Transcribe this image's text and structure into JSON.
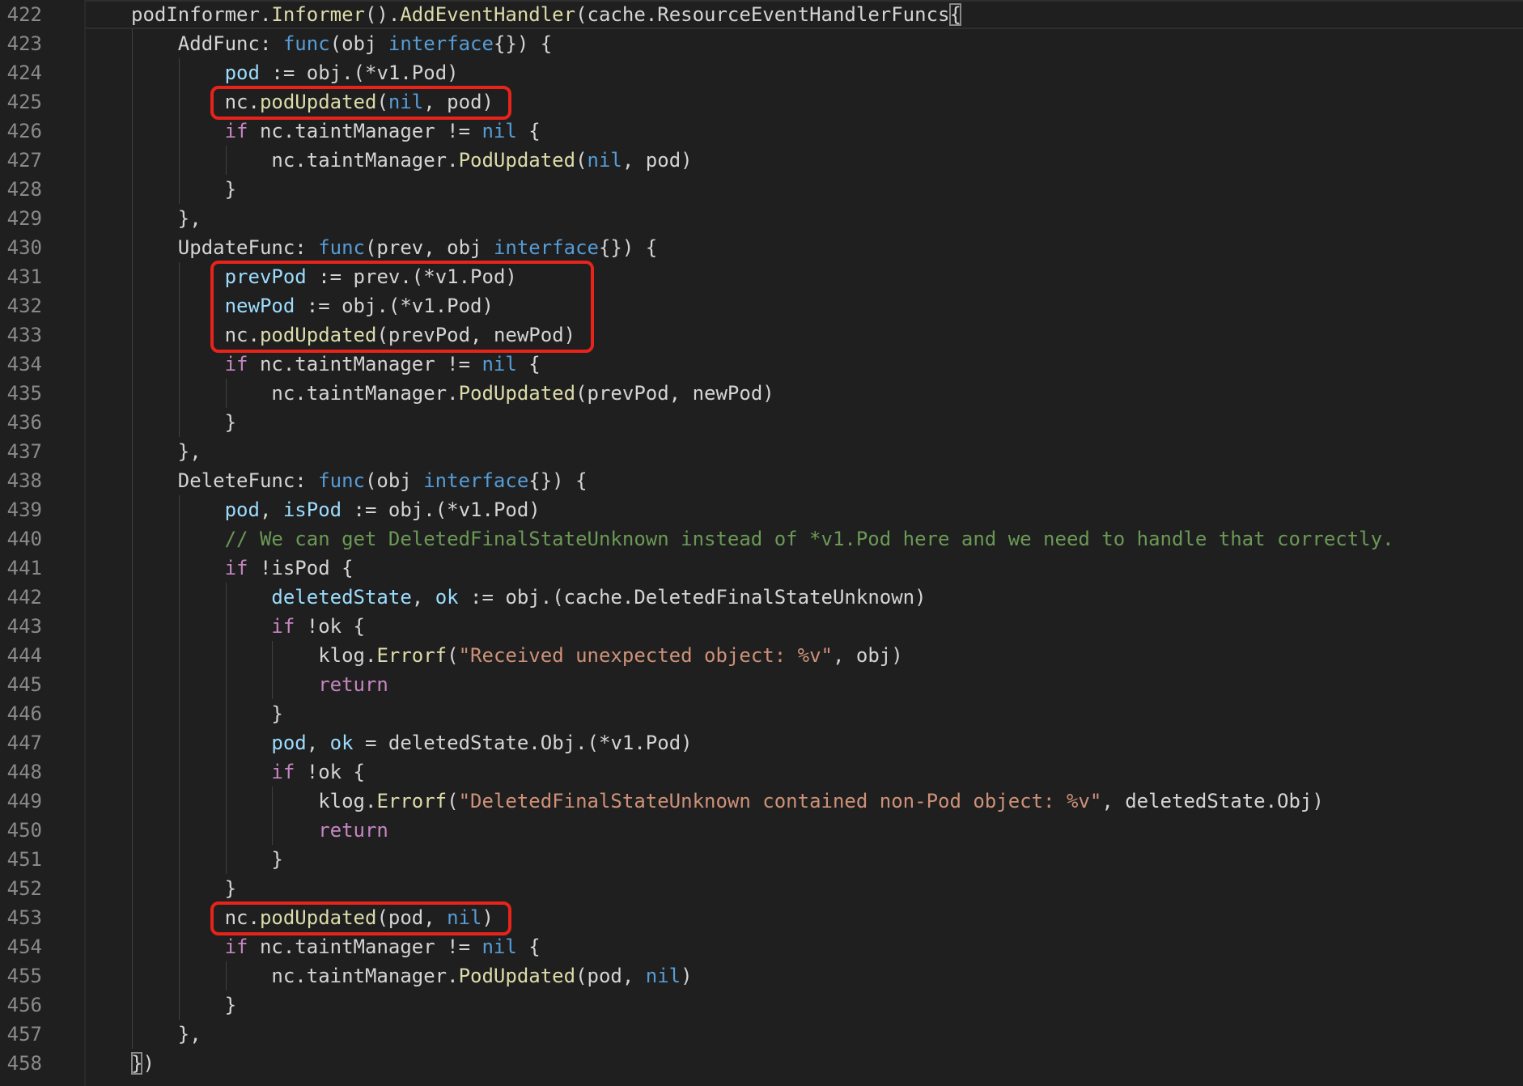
{
  "editor": {
    "language": "go",
    "first_line": 422,
    "lines": [
      {
        "n": "422",
        "indent": 0,
        "tokens": [
          [
            "txt",
            "podInformer."
          ],
          [
            "fn",
            "Informer"
          ],
          [
            "txt",
            "()."
          ],
          [
            "fn",
            "AddEventHandler"
          ],
          [
            "txt",
            "(cache.ResourceEventHandlerFuncs"
          ],
          [
            "brk",
            "{"
          ]
        ]
      },
      {
        "n": "423",
        "indent": 1,
        "tokens": [
          [
            "txt",
            "AddFunc: "
          ],
          [
            "kw",
            "func"
          ],
          [
            "txt",
            "(obj "
          ],
          [
            "kw",
            "interface"
          ],
          [
            "txt",
            "{}) {"
          ]
        ]
      },
      {
        "n": "424",
        "indent": 2,
        "tokens": [
          [
            "var",
            "pod"
          ],
          [
            "txt",
            " := obj.(*v1.Pod)"
          ]
        ]
      },
      {
        "n": "425",
        "indent": 2,
        "tokens": [
          [
            "txt",
            "nc."
          ],
          [
            "fn",
            "podUpdated"
          ],
          [
            "txt",
            "("
          ],
          [
            "kw",
            "nil"
          ],
          [
            "txt",
            ", pod)"
          ]
        ]
      },
      {
        "n": "426",
        "indent": 2,
        "tokens": [
          [
            "ctl",
            "if"
          ],
          [
            "txt",
            " nc.taintManager != "
          ],
          [
            "kw",
            "nil"
          ],
          [
            "txt",
            " {"
          ]
        ]
      },
      {
        "n": "427",
        "indent": 3,
        "tokens": [
          [
            "txt",
            "nc.taintManager."
          ],
          [
            "fn",
            "PodUpdated"
          ],
          [
            "txt",
            "("
          ],
          [
            "kw",
            "nil"
          ],
          [
            "txt",
            ", pod)"
          ]
        ]
      },
      {
        "n": "428",
        "indent": 2,
        "tokens": [
          [
            "txt",
            "}"
          ]
        ]
      },
      {
        "n": "429",
        "indent": 1,
        "tokens": [
          [
            "txt",
            "},"
          ]
        ]
      },
      {
        "n": "430",
        "indent": 1,
        "tokens": [
          [
            "txt",
            "UpdateFunc: "
          ],
          [
            "kw",
            "func"
          ],
          [
            "txt",
            "(prev, obj "
          ],
          [
            "kw",
            "interface"
          ],
          [
            "txt",
            "{}) {"
          ]
        ]
      },
      {
        "n": "431",
        "indent": 2,
        "tokens": [
          [
            "var",
            "prevPod"
          ],
          [
            "txt",
            " := prev.(*v1.Pod)"
          ]
        ]
      },
      {
        "n": "432",
        "indent": 2,
        "tokens": [
          [
            "var",
            "newPod"
          ],
          [
            "txt",
            " := obj.(*v1.Pod)"
          ]
        ]
      },
      {
        "n": "433",
        "indent": 2,
        "tokens": [
          [
            "txt",
            "nc."
          ],
          [
            "fn",
            "podUpdated"
          ],
          [
            "txt",
            "(prevPod, newPod)"
          ]
        ]
      },
      {
        "n": "434",
        "indent": 2,
        "tokens": [
          [
            "ctl",
            "if"
          ],
          [
            "txt",
            " nc.taintManager != "
          ],
          [
            "kw",
            "nil"
          ],
          [
            "txt",
            " {"
          ]
        ]
      },
      {
        "n": "435",
        "indent": 3,
        "tokens": [
          [
            "txt",
            "nc.taintManager."
          ],
          [
            "fn",
            "PodUpdated"
          ],
          [
            "txt",
            "(prevPod, newPod)"
          ]
        ]
      },
      {
        "n": "436",
        "indent": 2,
        "tokens": [
          [
            "txt",
            "}"
          ]
        ]
      },
      {
        "n": "437",
        "indent": 1,
        "tokens": [
          [
            "txt",
            "},"
          ]
        ]
      },
      {
        "n": "438",
        "indent": 1,
        "tokens": [
          [
            "txt",
            "DeleteFunc: "
          ],
          [
            "kw",
            "func"
          ],
          [
            "txt",
            "(obj "
          ],
          [
            "kw",
            "interface"
          ],
          [
            "txt",
            "{}) {"
          ]
        ]
      },
      {
        "n": "439",
        "indent": 2,
        "tokens": [
          [
            "var",
            "pod"
          ],
          [
            "txt",
            ", "
          ],
          [
            "var",
            "isPod"
          ],
          [
            "txt",
            " := obj.(*v1.Pod)"
          ]
        ]
      },
      {
        "n": "440",
        "indent": 2,
        "tokens": [
          [
            "cmt",
            "// We can get DeletedFinalStateUnknown instead of *v1.Pod here and we need to handle that correctly."
          ]
        ]
      },
      {
        "n": "441",
        "indent": 2,
        "tokens": [
          [
            "ctl",
            "if"
          ],
          [
            "txt",
            " !isPod {"
          ]
        ]
      },
      {
        "n": "442",
        "indent": 3,
        "tokens": [
          [
            "var",
            "deletedState"
          ],
          [
            "txt",
            ", "
          ],
          [
            "var",
            "ok"
          ],
          [
            "txt",
            " := obj.(cache.DeletedFinalStateUnknown)"
          ]
        ]
      },
      {
        "n": "443",
        "indent": 3,
        "tokens": [
          [
            "ctl",
            "if"
          ],
          [
            "txt",
            " !ok {"
          ]
        ]
      },
      {
        "n": "444",
        "indent": 4,
        "tokens": [
          [
            "txt",
            "klog."
          ],
          [
            "fn",
            "Errorf"
          ],
          [
            "txt",
            "("
          ],
          [
            "str",
            "\"Received unexpected object: %v\""
          ],
          [
            "txt",
            ", obj)"
          ]
        ]
      },
      {
        "n": "445",
        "indent": 4,
        "tokens": [
          [
            "ctl",
            "return"
          ]
        ]
      },
      {
        "n": "446",
        "indent": 3,
        "tokens": [
          [
            "txt",
            "}"
          ]
        ]
      },
      {
        "n": "447",
        "indent": 3,
        "tokens": [
          [
            "var",
            "pod"
          ],
          [
            "txt",
            ", "
          ],
          [
            "var",
            "ok"
          ],
          [
            "txt",
            " = deletedState.Obj.(*v1.Pod)"
          ]
        ]
      },
      {
        "n": "448",
        "indent": 3,
        "tokens": [
          [
            "ctl",
            "if"
          ],
          [
            "txt",
            " !ok {"
          ]
        ]
      },
      {
        "n": "449",
        "indent": 4,
        "tokens": [
          [
            "txt",
            "klog."
          ],
          [
            "fn",
            "Errorf"
          ],
          [
            "txt",
            "("
          ],
          [
            "str",
            "\"DeletedFinalStateUnknown contained non-Pod object: %v\""
          ],
          [
            "txt",
            ", deletedState.Obj)"
          ]
        ]
      },
      {
        "n": "450",
        "indent": 4,
        "tokens": [
          [
            "ctl",
            "return"
          ]
        ]
      },
      {
        "n": "451",
        "indent": 3,
        "tokens": [
          [
            "txt",
            "}"
          ]
        ]
      },
      {
        "n": "452",
        "indent": 2,
        "tokens": [
          [
            "txt",
            "}"
          ]
        ]
      },
      {
        "n": "453",
        "indent": 2,
        "tokens": [
          [
            "txt",
            "nc."
          ],
          [
            "fn",
            "podUpdated"
          ],
          [
            "txt",
            "(pod, "
          ],
          [
            "kw",
            "nil"
          ],
          [
            "txt",
            ")"
          ]
        ]
      },
      {
        "n": "454",
        "indent": 2,
        "tokens": [
          [
            "ctl",
            "if"
          ],
          [
            "txt",
            " nc.taintManager != "
          ],
          [
            "kw",
            "nil"
          ],
          [
            "txt",
            " {"
          ]
        ]
      },
      {
        "n": "455",
        "indent": 3,
        "tokens": [
          [
            "txt",
            "nc.taintManager."
          ],
          [
            "fn",
            "PodUpdated"
          ],
          [
            "txt",
            "(pod, "
          ],
          [
            "kw",
            "nil"
          ],
          [
            "txt",
            ")"
          ]
        ]
      },
      {
        "n": "456",
        "indent": 2,
        "tokens": [
          [
            "txt",
            "}"
          ]
        ]
      },
      {
        "n": "457",
        "indent": 1,
        "tokens": [
          [
            "txt",
            "},"
          ]
        ]
      },
      {
        "n": "458",
        "indent": 0,
        "tokens": [
          [
            "brk",
            "}"
          ],
          [
            "txt",
            ")"
          ]
        ]
      }
    ],
    "highlighted_lines": [
      [
        425,
        425
      ],
      [
        431,
        433
      ],
      [
        453,
        453
      ]
    ],
    "colors": {
      "background": "#1f1f1f",
      "line_number": "#8a8a8a",
      "text": "#d4d4d4",
      "keyword": "#569cd6",
      "control": "#c586c0",
      "function": "#dcdcaa",
      "variable": "#9cdcfe",
      "string": "#ce9178",
      "comment": "#6a9955",
      "highlight_box": "#e8231a"
    }
  }
}
